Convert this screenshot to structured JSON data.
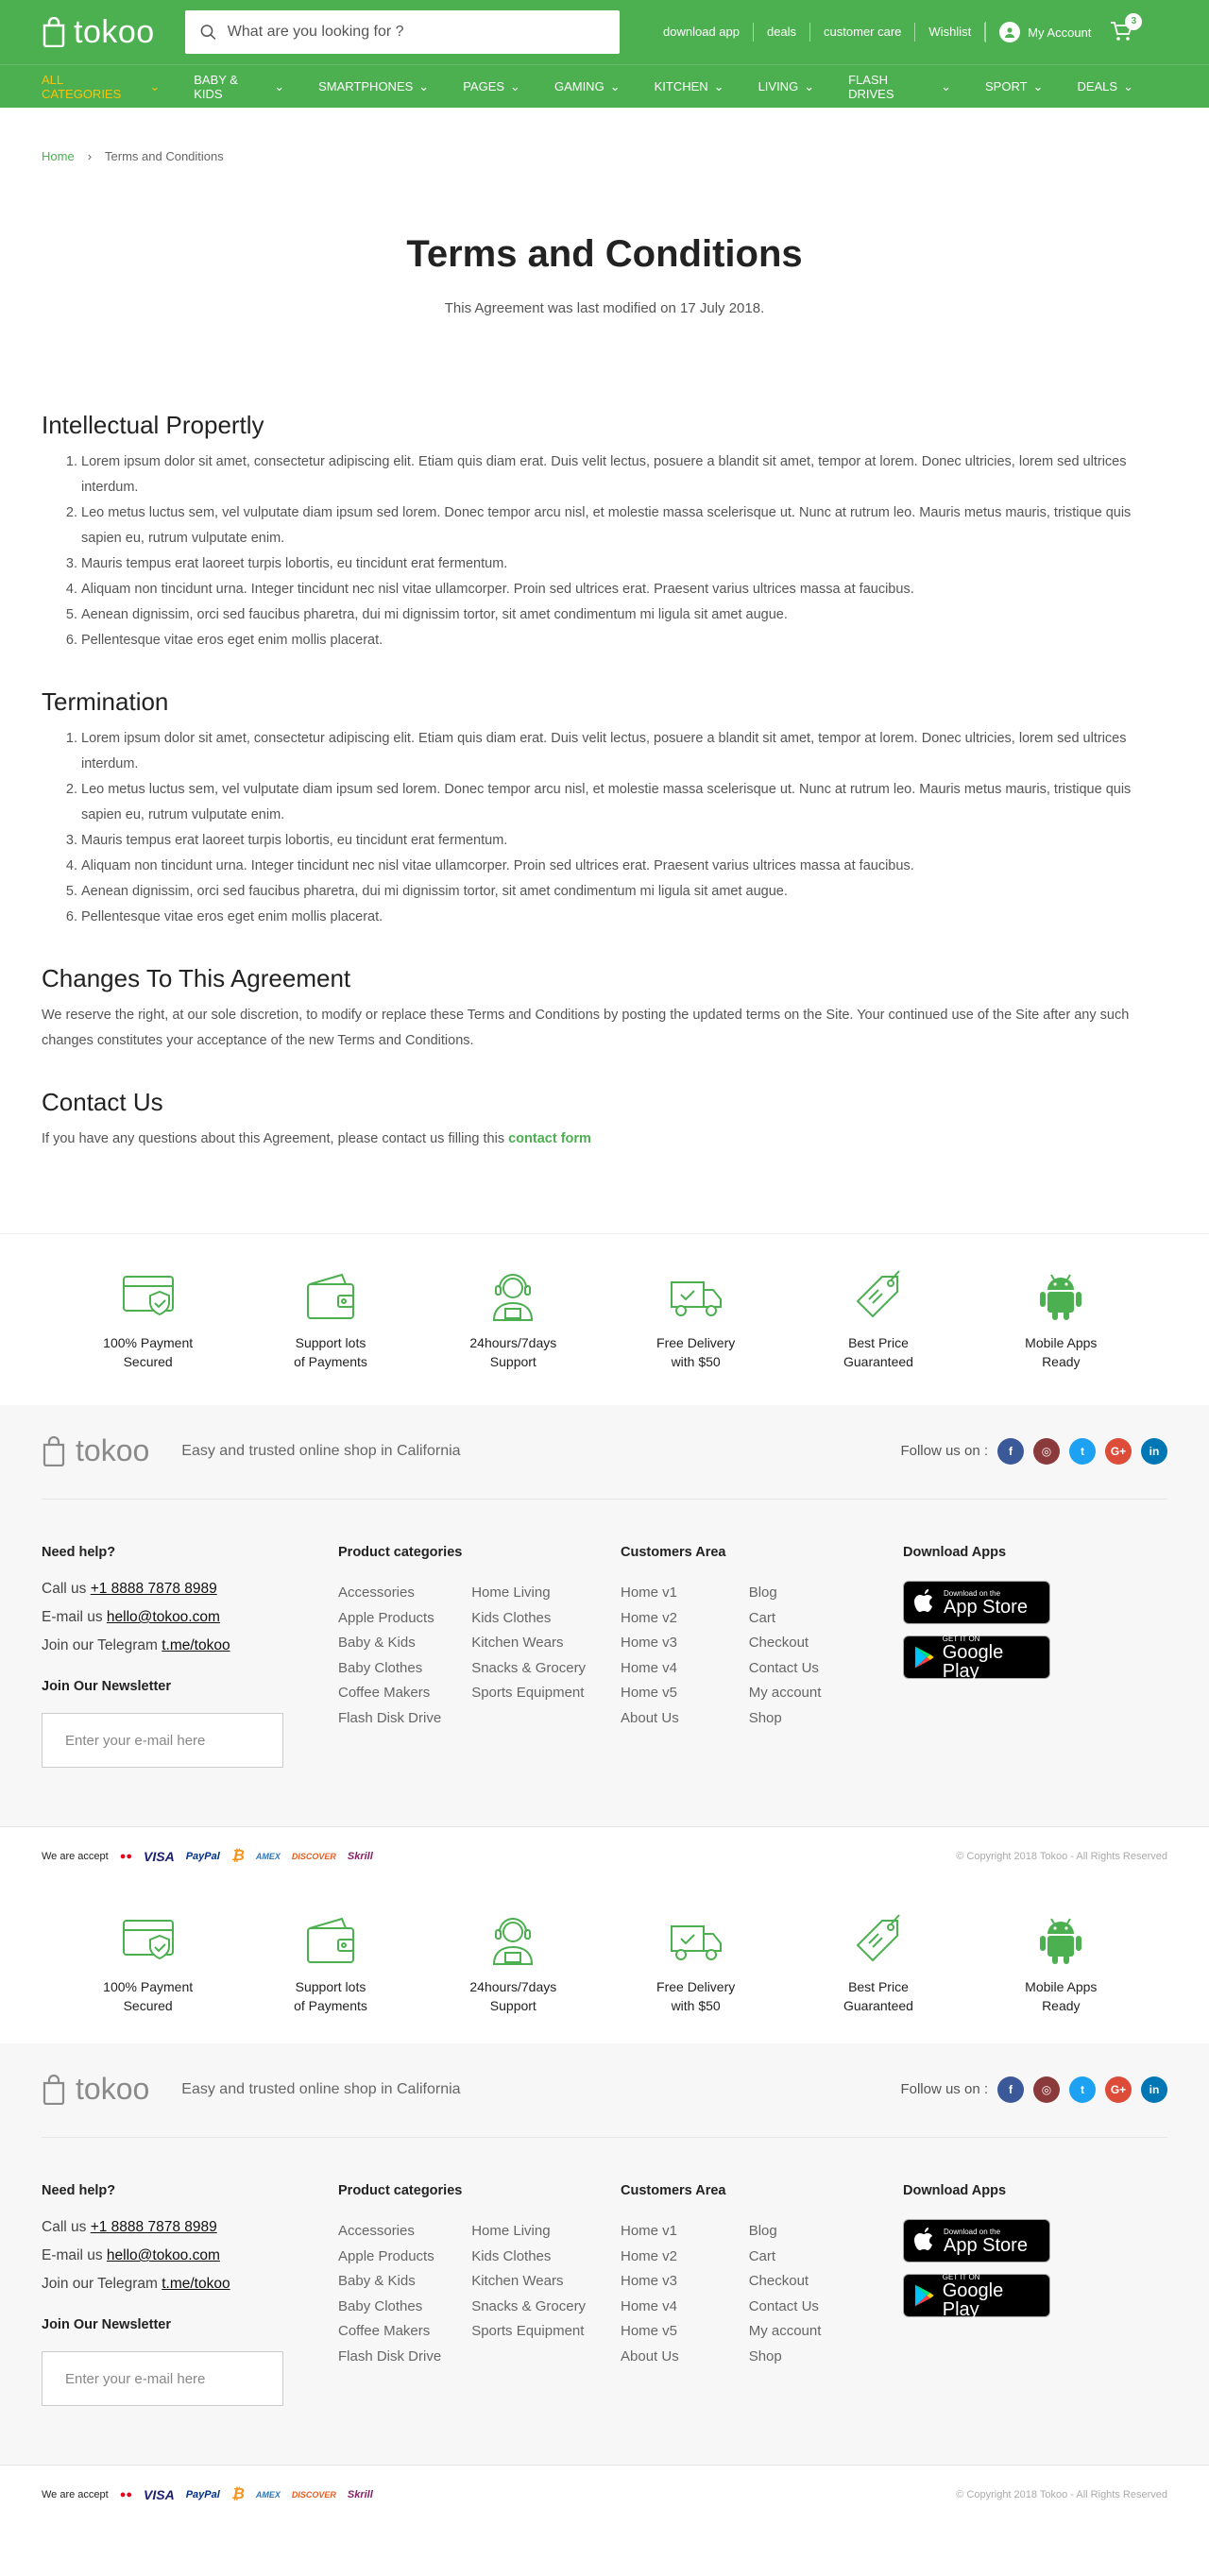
{
  "header": {
    "logo": "tokoo",
    "search_placeholder": "What are you looking for ?",
    "links": [
      "download app",
      "deals",
      "customer care",
      "Wishlist"
    ],
    "account": "My Account",
    "cart_count": "3"
  },
  "nav": [
    {
      "label": "All Categories",
      "active": true
    },
    {
      "label": "Baby & Kids"
    },
    {
      "label": "Smartphones"
    },
    {
      "label": "Pages"
    },
    {
      "label": "Gaming"
    },
    {
      "label": "Kitchen"
    },
    {
      "label": "Living"
    },
    {
      "label": "Flash Drives"
    },
    {
      "label": "Sport"
    },
    {
      "label": "Deals"
    }
  ],
  "breadcrumb": {
    "home": "Home",
    "current": "Terms and Conditions"
  },
  "page": {
    "title": "Terms and Conditions",
    "subtitle": "This Agreement was last modified on 17 July 2018."
  },
  "sections": {
    "ip": {
      "title": "Intellectual Propertly",
      "items": [
        "Lorem ipsum dolor sit amet, consectetur adipiscing elit. Etiam quis diam erat. Duis velit lectus, posuere a blandit sit amet, tempor at lorem. Donec ultricies, lorem sed ultrices interdum.",
        "Leo metus luctus sem, vel vulputate diam ipsum sed lorem. Donec tempor arcu nisl, et molestie massa scelerisque ut. Nunc at rutrum leo. Mauris metus mauris, tristique quis sapien eu, rutrum vulputate enim.",
        "Mauris tempus erat laoreet turpis lobortis, eu tincidunt erat fermentum.",
        "Aliquam non tincidunt urna. Integer tincidunt nec nisl vitae ullamcorper. Proin sed ultrices erat. Praesent varius ultrices massa at faucibus.",
        "Aenean dignissim, orci sed faucibus pharetra, dui mi dignissim tortor, sit amet condimentum mi ligula sit amet augue.",
        "Pellentesque vitae eros eget enim mollis placerat."
      ]
    },
    "termination": {
      "title": "Termination",
      "items": [
        "Lorem ipsum dolor sit amet, consectetur adipiscing elit. Etiam quis diam erat. Duis velit lectus, posuere a blandit sit amet, tempor at lorem. Donec ultricies, lorem sed ultrices interdum.",
        "Leo metus luctus sem, vel vulputate diam ipsum sed lorem. Donec tempor arcu nisl, et molestie massa scelerisque ut. Nunc at rutrum leo. Mauris metus mauris, tristique quis sapien eu, rutrum vulputate enim.",
        "Mauris tempus erat laoreet turpis lobortis, eu tincidunt erat fermentum.",
        "Aliquam non tincidunt urna. Integer tincidunt nec nisl vitae ullamcorper. Proin sed ultrices erat. Praesent varius ultrices massa at faucibus.",
        "Aenean dignissim, orci sed faucibus pharetra, dui mi dignissim tortor, sit amet condimentum mi ligula sit amet augue.",
        "Pellentesque vitae eros eget enim mollis placerat."
      ]
    },
    "changes": {
      "title": "Changes To This Agreement",
      "text": "We reserve the right, at our sole discretion, to modify or replace these Terms and Conditions by posting the updated terms on the Site. Your continued use of the Site after any such changes constitutes your acceptance of the new Terms and Conditions."
    },
    "contact": {
      "title": "Contact Us",
      "text": "If you have any questions about this Agreement, please contact us filling this",
      "link": "contact form"
    }
  },
  "features": [
    {
      "icon": "payment-secured-icon",
      "line1": "100% Payment",
      "line2": "Secured"
    },
    {
      "icon": "wallet-icon",
      "line1": "Support lots",
      "line2": "of Payments"
    },
    {
      "icon": "support-agent-icon",
      "line1": "24hours/7days",
      "line2": "Support"
    },
    {
      "icon": "delivery-truck-icon",
      "line1": "Free Delivery",
      "line2": "with $50"
    },
    {
      "icon": "price-tag-icon",
      "line1": "Best Price",
      "line2": "Guaranteed"
    },
    {
      "icon": "android-icon",
      "line1": "Mobile Apps",
      "line2": "Ready"
    }
  ],
  "footer": {
    "logo": "tokoo",
    "tagline": "Easy and trusted online shop in California",
    "follow_label": "Follow us on :",
    "social": [
      {
        "name": "facebook-icon",
        "glyph": "f",
        "color": "#3b5998"
      },
      {
        "name": "instagram-icon",
        "glyph": "◎",
        "color": "#8a3a3a"
      },
      {
        "name": "twitter-icon",
        "glyph": "t",
        "color": "#1da1f2"
      },
      {
        "name": "google-plus-icon",
        "glyph": "G+",
        "color": "#dd4b39"
      },
      {
        "name": "linkedin-icon",
        "glyph": "in",
        "color": "#0077b5"
      }
    ],
    "help": {
      "title": "Need help?",
      "call_label": "Call us ",
      "phone": "+1 8888 7878 8989",
      "email_label": "E-mail us ",
      "email": "hello@tokoo.com",
      "telegram_label": "Join our Telegram ",
      "telegram": "t.me/tokoo",
      "newsletter_title": "Join Our Newsletter",
      "newsletter_placeholder": "Enter your e-mail here"
    },
    "product_categories": {
      "title": "Product categories",
      "col1": [
        "Accessories",
        "Apple Products",
        "Baby & Kids",
        "Baby Clothes",
        "Coffee Makers",
        "Flash Disk Drive"
      ],
      "col2": [
        "Home Living",
        "Kids Clothes",
        "Kitchen Wears",
        "Snacks & Grocery",
        "Sports Equipment"
      ]
    },
    "customers_area": {
      "title": "Customers Area",
      "col1": [
        "Home v1",
        "Home v2",
        "Home v3",
        "Home v4",
        "Home v5",
        "About Us"
      ],
      "col2": [
        "Blog",
        "Cart",
        "Checkout",
        "Contact Us",
        "My account",
        "Shop"
      ]
    },
    "apps": {
      "title": "Download Apps",
      "appstore_small": "Download on the",
      "appstore_big": "App Store",
      "play_small": "GET IT ON",
      "play_big": "Google Play"
    },
    "accept_label": "We are accept",
    "payments": [
      {
        "name": "mastercard-icon",
        "label": "●●",
        "color": "#eb001b"
      },
      {
        "name": "visa-icon",
        "label": "VISA",
        "color": "#1a1f71"
      },
      {
        "name": "paypal-icon",
        "label": "PayPal",
        "color": "#003087"
      },
      {
        "name": "bitcoin-icon",
        "label": "₿",
        "color": "#f7931a"
      },
      {
        "name": "amex-icon",
        "label": "AMEX",
        "color": "#2e77bb"
      },
      {
        "name": "discover-icon",
        "label": "DISCOVER",
        "color": "#e55c20"
      },
      {
        "name": "skrill-icon",
        "label": "Skrill",
        "color": "#862165"
      }
    ],
    "copyright": "© Copyright 2018 Tokoo - All Rights Reserved"
  }
}
